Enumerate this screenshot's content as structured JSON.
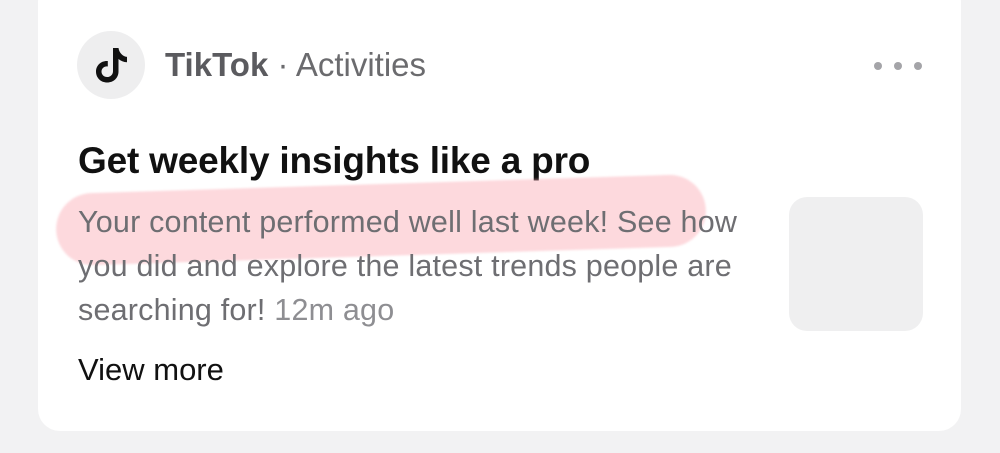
{
  "notification": {
    "app_name": "TikTok",
    "separator": " · ",
    "category": "Activities",
    "title": "Get weekly insights like a pro",
    "body": "Your content performed well last week! See how you did and explore the latest trends people are searching for!",
    "timestamp": "12m ago",
    "view_more_label": "View more",
    "icons": {
      "app": "tiktok-logo-icon",
      "menu": "more-horizontal-icon"
    },
    "colors": {
      "highlight": "#f8b3bc",
      "title": "#111111",
      "body": "#6e6e72"
    }
  }
}
